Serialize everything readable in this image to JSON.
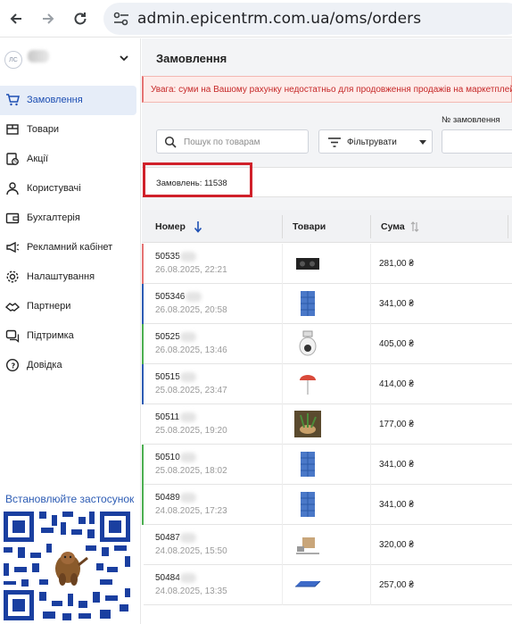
{
  "browser": {
    "url": "admin.epicentrm.com.ua/oms/orders",
    "back_icon": "arrow-left-icon",
    "forward_icon": "arrow-right-icon",
    "reload_icon": "reload-icon"
  },
  "sidebar": {
    "account_initials": "ЛС",
    "items": [
      {
        "label": "Замовлення",
        "icon": "cart-icon",
        "active": true
      },
      {
        "label": "Товари",
        "icon": "box-icon",
        "active": false
      },
      {
        "label": "Акції",
        "icon": "discount-icon",
        "active": false
      },
      {
        "label": "Користувачі",
        "icon": "users-icon",
        "active": false
      },
      {
        "label": "Бухгалтерія",
        "icon": "wallet-icon",
        "active": false
      },
      {
        "label": "Рекламний кабінет",
        "icon": "megaphone-icon",
        "active": false
      },
      {
        "label": "Налаштування",
        "icon": "gear-icon",
        "active": false
      },
      {
        "label": "Партнери",
        "icon": "handshake-icon",
        "active": false
      },
      {
        "label": "Підтримка",
        "icon": "chat-icon",
        "active": false
      },
      {
        "label": "Довідка",
        "icon": "info-icon",
        "active": false
      }
    ],
    "install_label": "Встановлюйте застосунок"
  },
  "main": {
    "title": "Замовлення",
    "alert": "Увага: суми на Вашому рахунку недостатньо для продовження продажів на маркетплейс",
    "order_number_label": "№ замовлення",
    "search_placeholder": "Пошук по товарам",
    "filter_label": "Фільтрувати",
    "orders_count": "Замовлень: 11538"
  },
  "table": {
    "columns": [
      "Номер",
      "Товари",
      "Сума"
    ],
    "rows": [
      {
        "number": "50535",
        "date": "26.08.2025, 22:21",
        "amount": "281,00 ₴",
        "thumb": "gas-stove",
        "bar": "#e57373"
      },
      {
        "number": "505346",
        "date": "26.08.2025, 20:58",
        "amount": "341,00 ₴",
        "thumb": "shelf-cover",
        "bar": "#2d5cb4"
      },
      {
        "number": "50525",
        "date": "26.08.2025, 13:46",
        "amount": "405,00 ₴",
        "thumb": "camera",
        "bar": "#4caf50"
      },
      {
        "number": "50515",
        "date": "25.08.2025, 23:47",
        "amount": "414,00 ₴",
        "thumb": "umbrella",
        "bar": "#2d5cb4"
      },
      {
        "number": "50511",
        "date": "25.08.2025, 19:20",
        "amount": "177,00 ₴",
        "thumb": "plants",
        "bar": "#ffffff"
      },
      {
        "number": "50510",
        "date": "25.08.2025, 18:02",
        "amount": "341,00 ₴",
        "thumb": "shelf-cover",
        "bar": "#4caf50"
      },
      {
        "number": "50489",
        "date": "24.08.2025, 17:23",
        "amount": "341,00 ₴",
        "thumb": "shelf-cover",
        "bar": "#4caf50"
      },
      {
        "number": "50487",
        "date": "24.08.2025, 15:50",
        "amount": "320,00 ₴",
        "thumb": "tools",
        "bar": "#ffffff"
      },
      {
        "number": "50484",
        "date": "24.08.2025, 13:35",
        "amount": "257,00 ₴",
        "thumb": "mat",
        "bar": "#ffffff"
      }
    ]
  }
}
